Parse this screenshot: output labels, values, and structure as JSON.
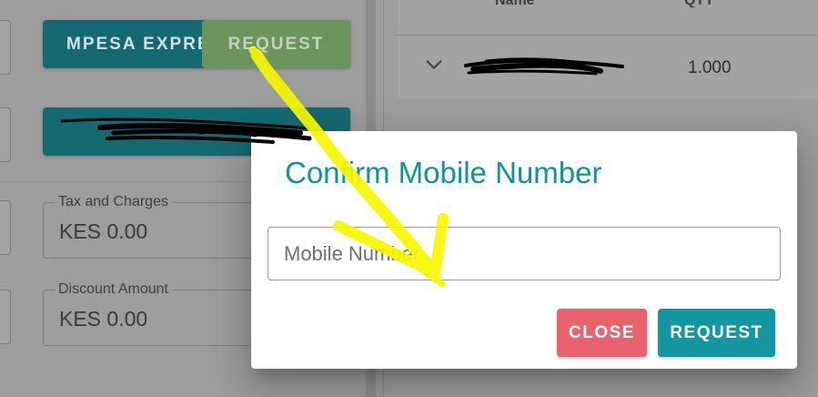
{
  "background": {
    "mpesa_button_label": "MPESA EXPRESS",
    "request_button_label": "REQUEST",
    "tax_field": {
      "label": "Tax and Charges",
      "value": "KES 0.00"
    },
    "discount_field": {
      "label": "Discount Amount",
      "value": "KES 0.00"
    },
    "table": {
      "headers": [
        "Name",
        "QTY"
      ],
      "rows": [
        {
          "qty": "1.000"
        }
      ]
    }
  },
  "dialog": {
    "title": "Confirm Mobile Number",
    "input_placeholder": "Mobile Number",
    "close_label": "CLOSE",
    "request_label": "REQUEST"
  },
  "colors": {
    "accent": "#1396a0",
    "close": "#e8636e",
    "annotation": "#f7f700"
  },
  "icons": [
    "chevron-down-icon"
  ]
}
